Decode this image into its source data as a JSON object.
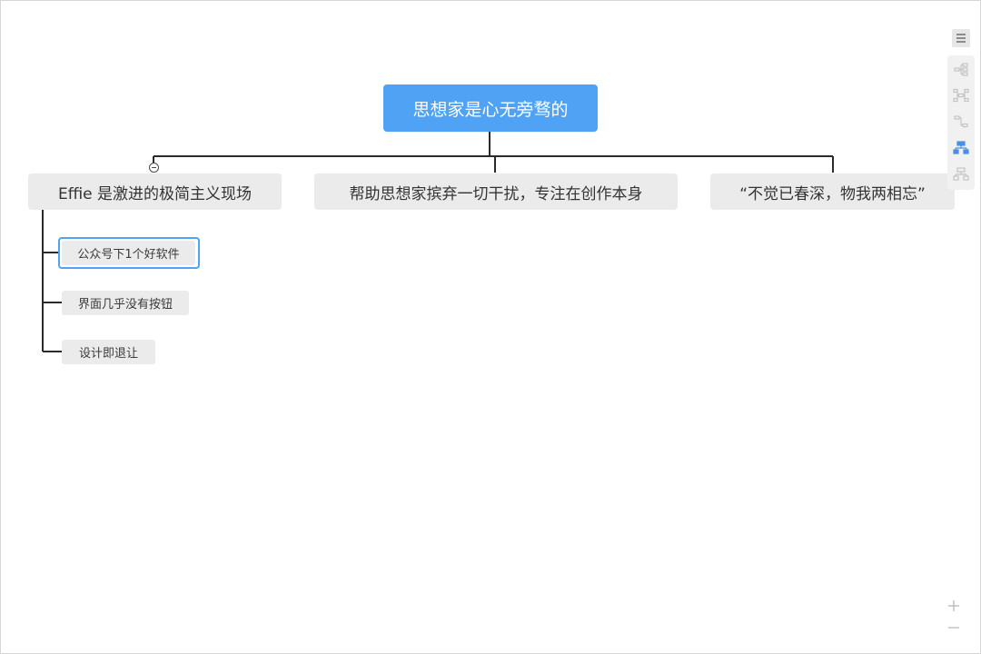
{
  "mindmap": {
    "root": {
      "label": "思想家是心无旁骛的"
    },
    "branches": [
      {
        "label": "Effie 是激进的极简主义现场",
        "expanded": true,
        "children": [
          {
            "label": "公众号下1个好软件",
            "selected": true
          },
          {
            "label": "界面几乎没有按钮"
          },
          {
            "label": "设计即退让"
          }
        ]
      },
      {
        "label": "帮助思想家摈弃一切干扰，专注在创作本身"
      },
      {
        "label": "“不觉已春深，物我两相忘”"
      }
    ]
  },
  "toolbar": {
    "menu_icon": "hamburger-menu-icon",
    "layouts": [
      {
        "icon": "layout-right-tree-icon",
        "active": false
      },
      {
        "icon": "layout-radial-icon",
        "active": false
      },
      {
        "icon": "layout-left-tree-icon",
        "active": false
      },
      {
        "icon": "layout-org-chart-icon",
        "active": true
      },
      {
        "icon": "layout-org-chart-alt-icon",
        "active": false
      }
    ],
    "zoom_in_icon": "plus-icon",
    "zoom_out_icon": "minus-icon"
  },
  "colors": {
    "root_fill": "#4fa2f4",
    "node_fill": "#ebebeb",
    "connector": "#2b2b2b",
    "selection": "#4fa2f4",
    "active_icon": "#4a90e2",
    "inactive_icon": "#c4c4c4"
  }
}
